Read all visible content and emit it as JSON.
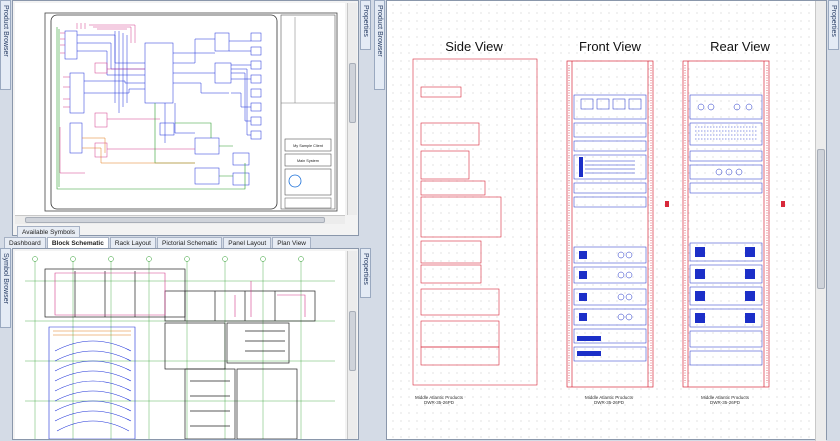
{
  "left_top": {
    "side_tab": "Product Browser",
    "props_tab": "Properties",
    "available_symbols": "Available Symbols",
    "title_block": {
      "client": "My Sample Client",
      "system": "Main System"
    }
  },
  "tabs": [
    {
      "label": "Dashboard",
      "active": false
    },
    {
      "label": "Block Schematic",
      "active": true
    },
    {
      "label": "Rack Layout",
      "active": false
    },
    {
      "label": "Pictorial Schematic",
      "active": false
    },
    {
      "label": "Panel Layout",
      "active": false
    },
    {
      "label": "Plan View",
      "active": false
    }
  ],
  "left_bottom": {
    "side_tab": "Symbol Browser",
    "props_tab": "Properties"
  },
  "right": {
    "side_tab": "Product Browser",
    "props_tab": "Properties",
    "views": [
      {
        "title": "Side View",
        "caption1": "Middle Atlantic Products",
        "caption2": "DWR-35-26PD"
      },
      {
        "title": "Front View",
        "caption1": "Middle Atlantic Products",
        "caption2": "DWR-35-26PD"
      },
      {
        "title": "Rear View",
        "caption1": "Middle Atlantic Products",
        "caption2": "DWR-35-26PD"
      }
    ]
  },
  "colors": {
    "schematic_blue": "#1a2fd8",
    "schematic_pink": "#d23a8c",
    "schematic_green": "#2f9e2f",
    "rack_red": "#d8283a",
    "rack_blue": "#1c2fc8"
  }
}
